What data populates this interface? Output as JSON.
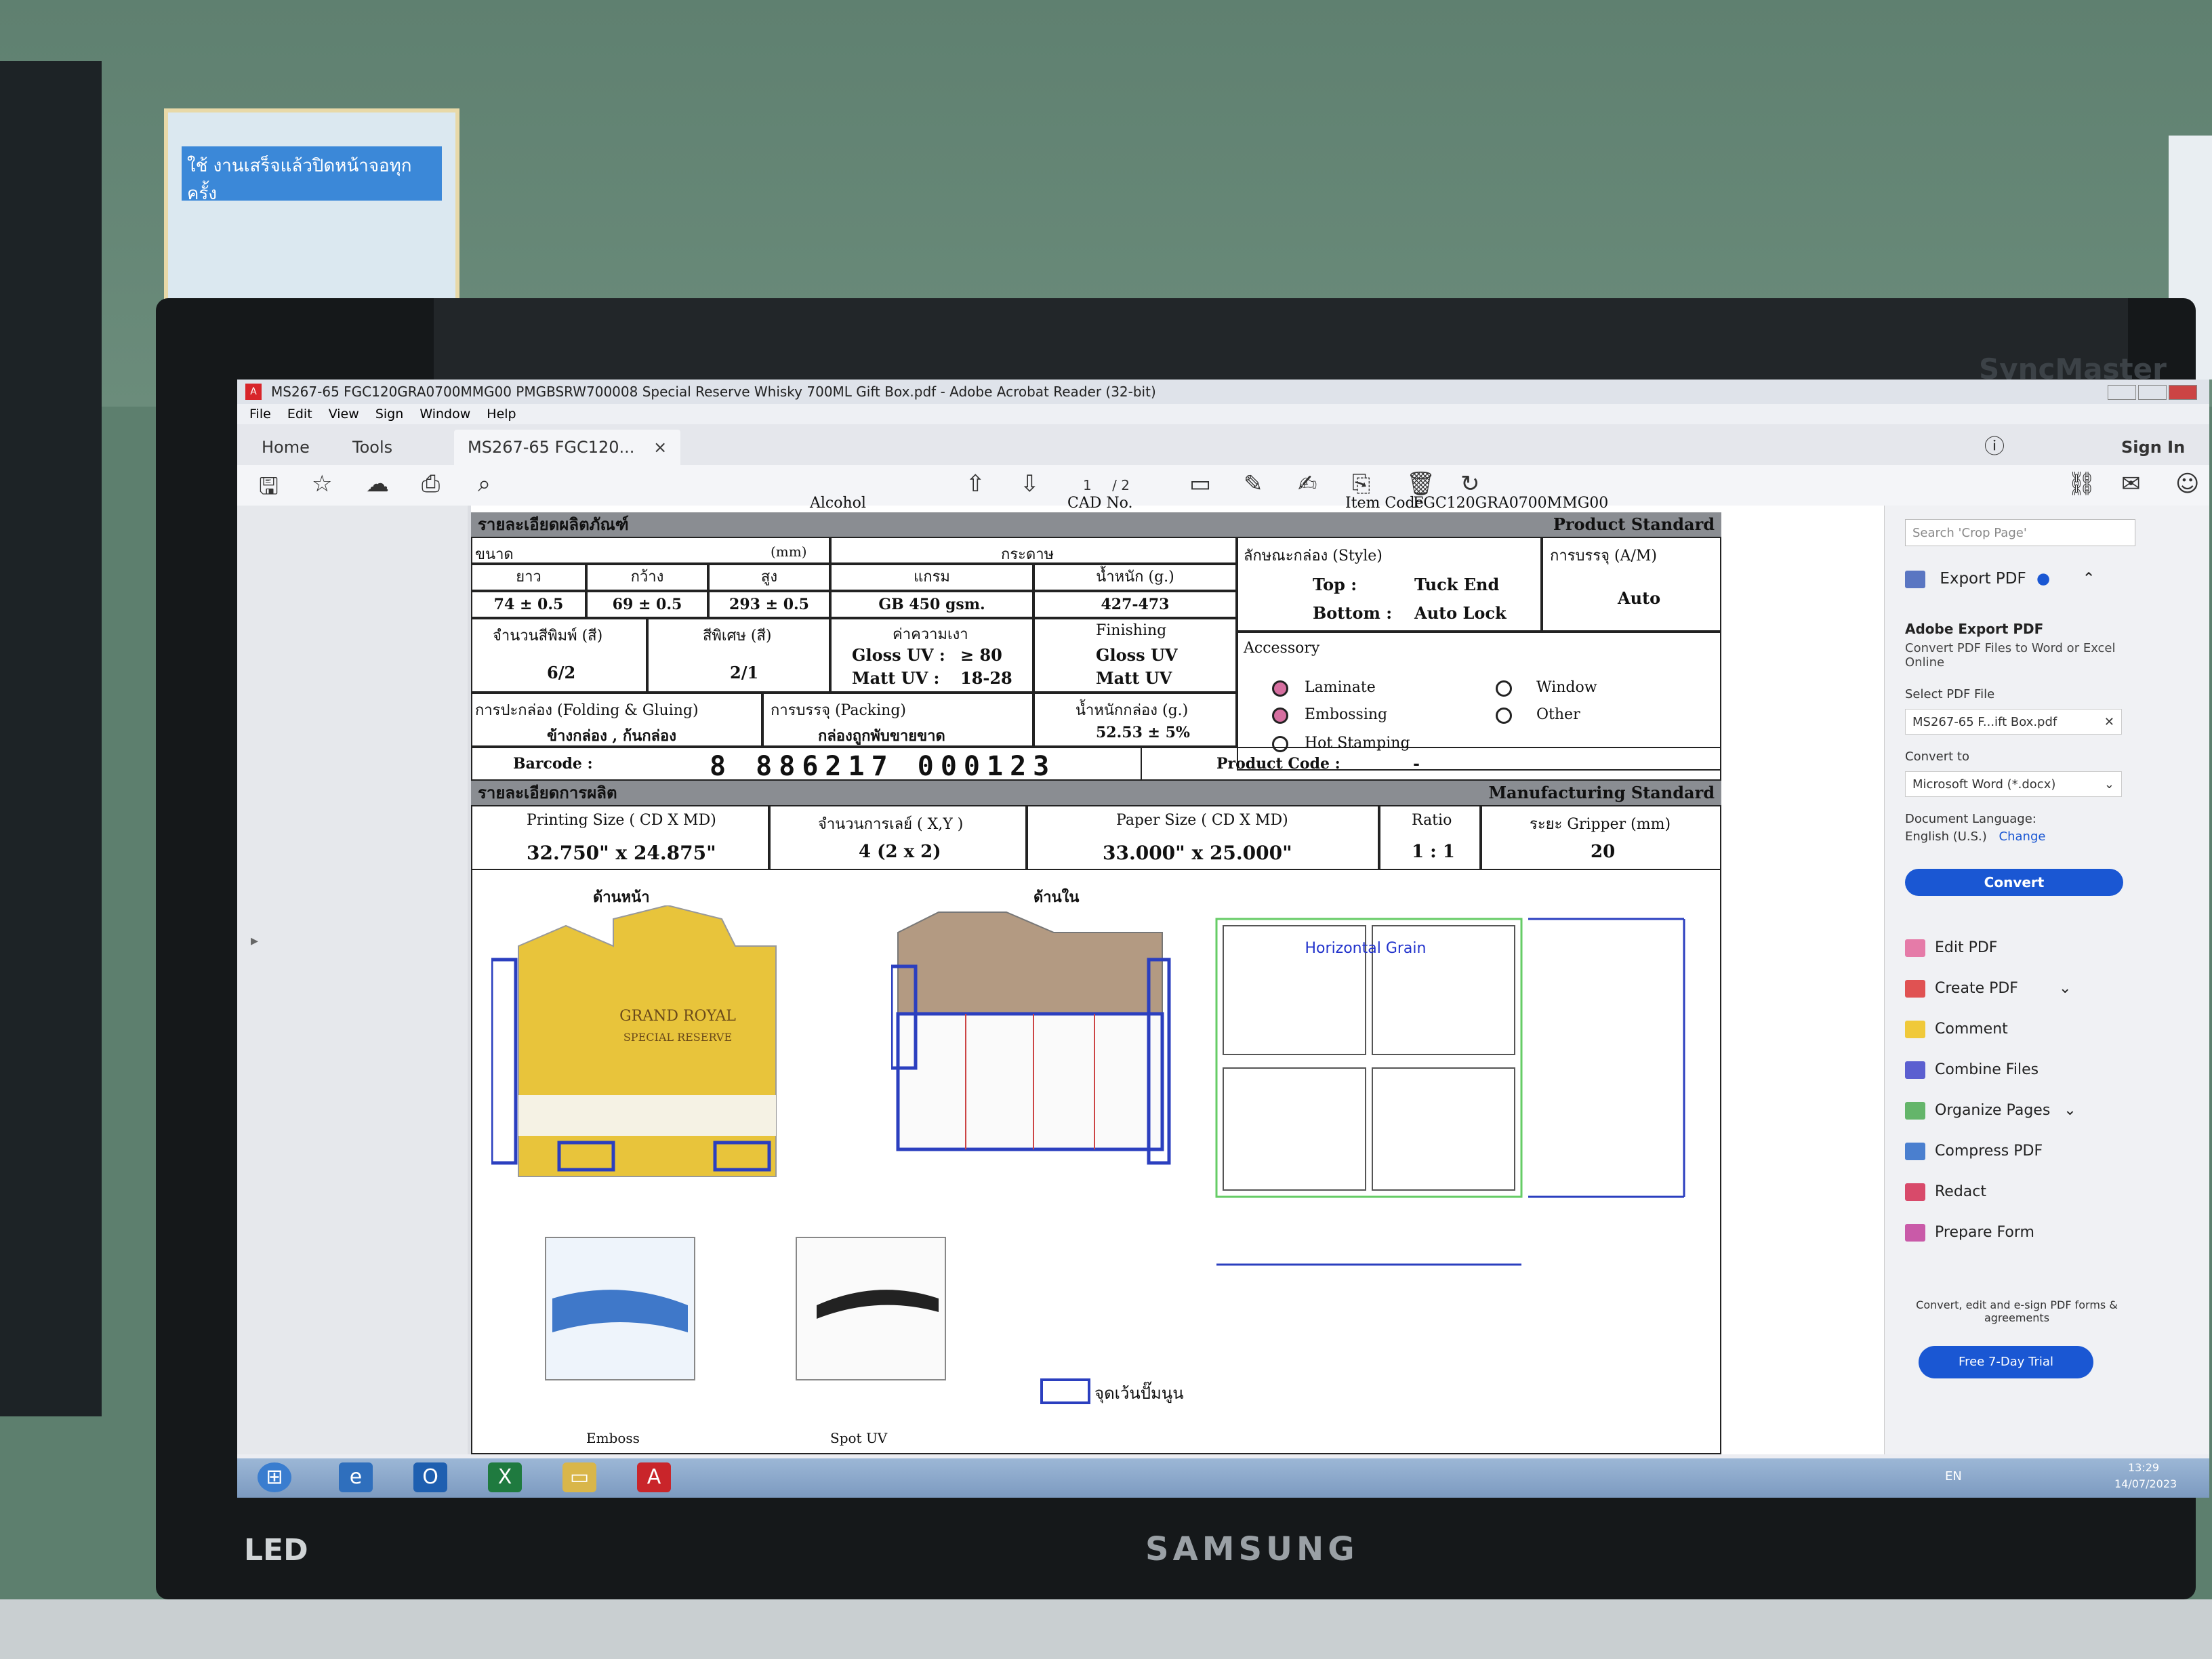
{
  "window": {
    "title": "MS267-65 FGC120GRA0700MMG00 PMGBSRW700008  Special Reserve Whisky 700ML Gift Box.pdf - Adobe Acrobat Reader (32-bit)"
  },
  "menu": [
    "File",
    "Edit",
    "View",
    "Sign",
    "Window",
    "Help"
  ],
  "tabs": {
    "home": "Home",
    "tools": "Tools",
    "doc": "MS267-65 FGC120...",
    "close": "×"
  },
  "topright": {
    "sign_in": "Sign In"
  },
  "pager": {
    "current": "1",
    "total": "/ 2"
  },
  "bezel": {
    "brand": "SAMSUNG",
    "model": "SyncMaster",
    "led": "LED"
  },
  "sticker": {
    "text": "ใช้ งานเสร็จแล้วปิดหน้าจอทุกครั้ง"
  },
  "sheet": {
    "cut_top": {
      "t1": "Alcohol",
      "t2": "CAD No.",
      "t3": "Item Code",
      "t4": "FGC120GRA0700MMG00"
    },
    "product_section": {
      "th": "รายละเอียดผลิตภัณฑ์",
      "en": "Product Standard"
    },
    "size_label": "ขนาด",
    "mm_label": "(mm)",
    "paper_label": "กระดาษ",
    "dim_headers": [
      "ยาว",
      "กว้าง",
      "สูง"
    ],
    "paper_headers": [
      "แกรม",
      "น้ำหนัก (g.)"
    ],
    "dim_values": [
      "74 ± 0.5",
      "69 ± 0.5",
      "293 ± 0.5"
    ],
    "paper_values": [
      "GB 450 gsm.",
      "427-473"
    ],
    "style_label": "ลักษณะกล่อง (Style)",
    "style_top_label": "Top :",
    "style_top_value": "Tuck End",
    "style_bottom_label": "Bottom :",
    "style_bottom_value": "Auto Lock",
    "pack_label": "การบรรจุ (A/M)",
    "pack_value": "Auto",
    "print_colors_label": "จำนวนสีพิมพ์ (สี)",
    "print_colors_value": "6/2",
    "special_colors_label": "สีพิเศษ (สี)",
    "special_colors_value": "2/1",
    "gloss_label": "ค่าความเงา",
    "gloss_uv": "Gloss UV :",
    "gloss_uv_value": "≥ 80",
    "matt_uv": "Matt UV :",
    "matt_uv_value": "18-28",
    "finishing_label": "Finishing",
    "finishing_values": [
      "Gloss UV",
      "Matt UV"
    ],
    "accessory_label": "Accessory",
    "accessories": [
      {
        "name": "Laminate",
        "checked": true
      },
      {
        "name": "Window",
        "checked": false
      },
      {
        "name": "Embossing",
        "checked": true
      },
      {
        "name": "Other",
        "checked": false
      },
      {
        "name": "Hot Stamping",
        "checked": false
      }
    ],
    "folding_label": "การปะกล่อง (Folding & Gluing)",
    "folding_value": "ข้างกล่อง , ก้นกล่อง",
    "packing_label": "การบรรจุ (Packing)",
    "packing_value": "กล่องถูกพับขายขาด",
    "box_weight_label": "น้ำหนักกล่อง (g.)",
    "box_weight_value": "52.53 ± 5%",
    "barcode_label": "Barcode :",
    "barcode_value": "8 886217 000123",
    "product_code_label": "Product Code :",
    "product_code_value": "-",
    "mfg_section": {
      "th": "รายละเอียดการผลิต",
      "en": "Manufacturing Standard"
    },
    "mfg_headers": [
      "Printing Size ( CD X MD)",
      "จำนวนการเลย์ ( X,Y )",
      "Paper  Size ( CD X MD)",
      "Ratio",
      "ระยะ Gripper (mm)"
    ],
    "mfg_values": [
      "32.750\" x 24.875\"",
      "4 (2 x 2)",
      "33.000\" x 25.000\"",
      "1 : 1",
      "20"
    ],
    "front_label": "ด้านหน้า",
    "back_label": "ด้านใน",
    "grain_label": "Horizontal Grain",
    "emboss_label": "Emboss",
    "spot_uv_label": "Spot UV",
    "note_label": "จุดเว้นปั๊มนูน",
    "brand_text": [
      "GRAND ROYAL",
      "SPECIAL RESERVE"
    ]
  },
  "right_panel": {
    "search_placeholder": "Search 'Crop Page'",
    "export_title": "Export PDF",
    "adobe_export": "Adobe Export PDF",
    "export_desc": "Convert PDF Files to Word or Excel Online",
    "select_label": "Select PDF File",
    "selected_file": "MS267-65 F...ift Box.pdf",
    "convert_to_label": "Convert to",
    "convert_to_value": "Microsoft Word (*.docx)",
    "doc_lang": "Document Language:",
    "lang_value": "English (U.S.)",
    "lang_change": "Change",
    "convert_btn": "Convert",
    "tools": [
      "Edit PDF",
      "Create PDF",
      "Comment",
      "Combine Files",
      "Organize Pages",
      "Compress PDF",
      "Redact",
      "Prepare Form"
    ],
    "promo": "Convert, edit and e-sign PDF forms & agreements",
    "trial_btn": "Free 7-Day Trial"
  },
  "taskbar": {
    "lang": "EN",
    "time": "13:29",
    "date": "14/07/2023"
  },
  "colors": {
    "accent": "#1a57d3",
    "acrobat_red": "#d8252a",
    "section_bar": "#8a8d92"
  }
}
